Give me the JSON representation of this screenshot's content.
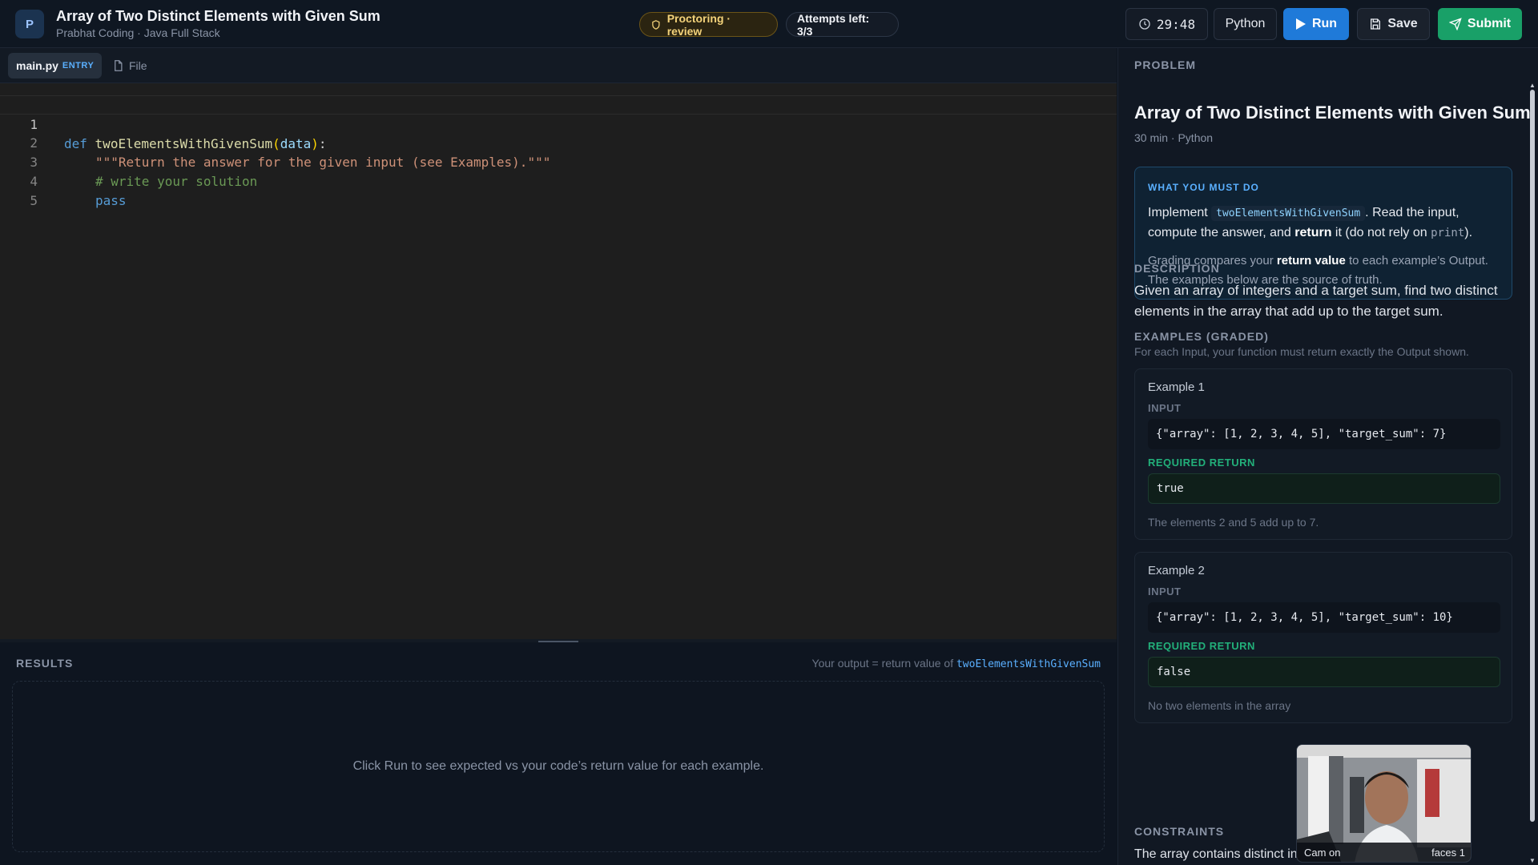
{
  "header": {
    "logo_letter": "P",
    "title": "Array of Two Distinct Elements with Given Sum",
    "subtitle": "Prabhat Coding · Java Full Stack",
    "proctoring": "Proctoring · review",
    "attempts": "Attempts left: 3/3",
    "timer": "29:48",
    "language": "Python",
    "run_label": "Run",
    "save_label": "Save",
    "submit_label": "Submit"
  },
  "files": {
    "main_tab": "main.py",
    "main_tag": "ENTRY",
    "file_tab": "File"
  },
  "editor": {
    "line_numbers": [
      "1",
      "2",
      "3",
      "4",
      "5"
    ],
    "lines": [
      {
        "kw": "def",
        "fn": "twoElementsWithGivenSum",
        "open": "(",
        "param": "data",
        "close": ")",
        "colon": ":"
      },
      {
        "text": "\"\"\"Return the answer for the given input (see Examples).\"\"\""
      },
      {
        "text": "# write your solution"
      },
      {
        "text": "pass"
      },
      {
        "text": ""
      }
    ]
  },
  "results": {
    "heading": "RESULTS",
    "note_prefix": "Your output = return value of",
    "note_fn": "twoElementsWithGivenSum",
    "empty_message": "Click Run to see expected vs your code’s return value for each example."
  },
  "problem": {
    "section_label": "PROBLEM",
    "title": "Array of Two Distinct Elements with Given Sum",
    "meta": "30 min · Python",
    "must_heading": "WHAT YOU MUST DO",
    "must_p1_a": "Implement",
    "must_fn": "twoElementsWithGivenSum",
    "must_p1_b": ". Read the input, compute the answer, and",
    "must_p1_return": "return",
    "must_p1_c": "it (do not rely on",
    "must_print": "print",
    "must_p1_d": ").",
    "must_p2_a": "Grading compares your",
    "must_p2_b": "return value",
    "must_p2_c": "to each example’s Output. The examples below are the source of truth.",
    "description_heading": "DESCRIPTION",
    "description": "Given an array of integers and a target sum, find two distinct elements in the array that add up to the target sum.",
    "examples_heading": "EXAMPLES (GRADED)",
    "examples_sub": "For each Input, your function must return exactly the Output shown.",
    "examples": [
      {
        "title": "Example 1",
        "input_label": "INPUT",
        "input": "{\"array\": [1, 2, 3, 4, 5], \"target_sum\": 7}",
        "return_label": "REQUIRED RETURN",
        "output": "true",
        "note": "The elements 2 and 5 add up to 7."
      },
      {
        "title": "Example 2",
        "input_label": "INPUT",
        "input": "{\"array\": [1, 2, 3, 4, 5], \"target_sum\": 10}",
        "return_label": "REQUIRED RETURN",
        "output": "false",
        "note": "No two elements in the array"
      }
    ],
    "constraints_heading": "CONSTRAINTS",
    "constraints_text": "The array contains distinct in"
  },
  "camera": {
    "status": "Cam on",
    "faces": "faces 1"
  },
  "colors": {
    "run": "#1f7ad9",
    "submit": "#19a068",
    "proctor_text": "#f3d27a",
    "required_return": "#22b07a"
  }
}
